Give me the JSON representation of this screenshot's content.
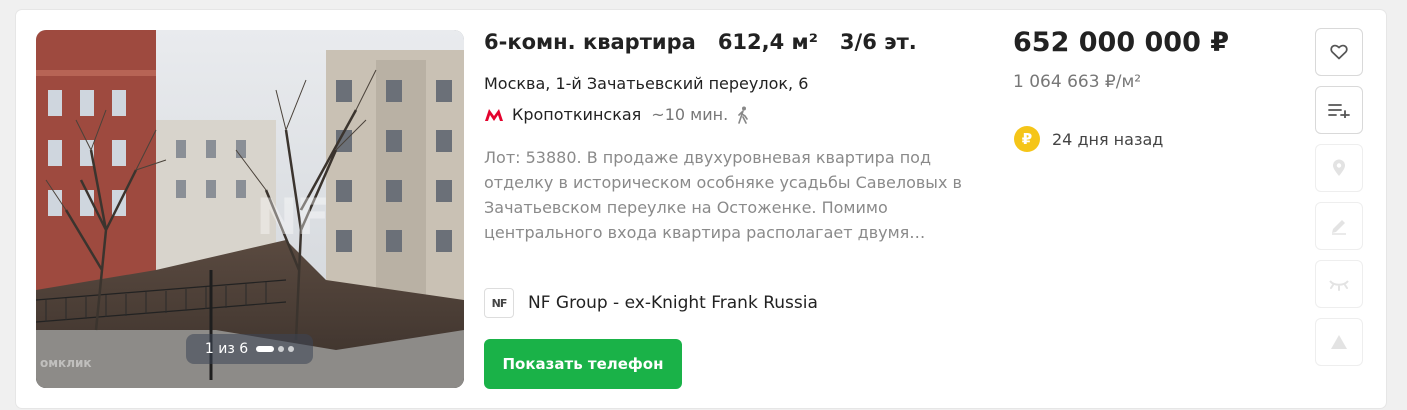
{
  "listing": {
    "rooms": "6-комн. квартира",
    "area": "612,4 м²",
    "floor": "3/6 эт.",
    "address": "Москва, 1-й Зачатьевский переулок, 6",
    "metro": {
      "station": "Кропоткинская",
      "time": "~10 мин.",
      "icon": "metro-m-icon",
      "walk_icon": "walking-person-icon",
      "color": "#e4032e"
    },
    "description": "Лот: 53880. В продаже двухуровневая квартира под отделку в историческом особняке усадьбы Савеловых в Зачатьевском переулке на Остоженке. Помимо центрального входа квартира располагает двумя…",
    "agency": {
      "name": "NF Group - ex-Knight Frank Russia",
      "logo_text": "NF"
    },
    "phone_button": "Показать телефон",
    "price": "652 000 000 ₽",
    "price_per_m2": "1 064 663 ₽/м²",
    "added": "24 дня назад",
    "added_icon": "ruble-coin-icon"
  },
  "gallery": {
    "counter": "1 из 6",
    "watermark": "NF",
    "watermark_small": "омклик"
  },
  "actions": [
    {
      "name": "favorite-button",
      "icon": "heart-icon",
      "enabled": true
    },
    {
      "name": "compare-button",
      "icon": "list-add-icon",
      "enabled": true
    },
    {
      "name": "map-button",
      "icon": "map-pin-icon",
      "enabled": false
    },
    {
      "name": "note-button",
      "icon": "pencil-icon",
      "enabled": false
    },
    {
      "name": "hide-button",
      "icon": "eye-closed-icon",
      "enabled": false
    },
    {
      "name": "report-button",
      "icon": "warning-icon",
      "enabled": false
    }
  ],
  "colors": {
    "accent_green": "#1ab248",
    "ruble_coin": "#f5c518"
  }
}
